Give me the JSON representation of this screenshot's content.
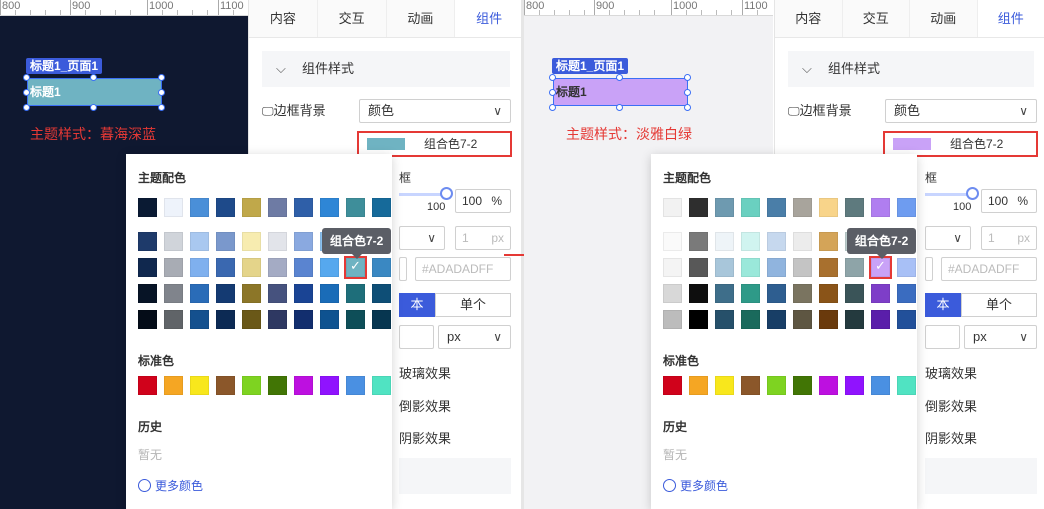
{
  "ruler": {
    "ticks": [
      "800",
      "900",
      "1000",
      "1100"
    ]
  },
  "panel": {
    "tabs": [
      "内容",
      "交互",
      "动画",
      "组件"
    ],
    "active_tab": "组件",
    "section_title": "组件样式",
    "border_bg_label": "边框背景",
    "border_bg_value": "颜色",
    "color_value_label": "组合色7-2",
    "percent_value": "100",
    "percent_unit": "%",
    "slider_max_label": "100",
    "px_value": "1",
    "px_unit_ghost": "px",
    "hex_placeholder": "#ADADADFF",
    "seg_left": "本",
    "seg_right": "单个",
    "unit_select": "px",
    "glass_label": "玻璃效果",
    "reflection_label": "倒影效果",
    "shadow_label": "阴影效果",
    "partial_label": "框"
  },
  "popup": {
    "theme_title": "主题配色",
    "standard_title": "标准色",
    "history_title": "历史",
    "history_empty": "暂无",
    "more_colors": "更多颜色",
    "tooltip": "组合色7-2",
    "standard_colors": [
      "#d0021b",
      "#f5a623",
      "#f8e71c",
      "#8b572a",
      "#7ed321",
      "#417505",
      "#bd10e0",
      "#9013fe",
      "#4a90e2",
      "#50e3c2"
    ]
  },
  "left": {
    "tag": "标题1_页面1",
    "widget_text": "标题1",
    "caption": "主题样式：暮海深蓝",
    "widget_color": "#6fb3c2",
    "swatch_color": "#6fb3c2",
    "theme_row": [
      "#0a1a33",
      "#eef3fb",
      "#4a8fd8",
      "#1e4a8a",
      "#c0a84a",
      "#6e7ba4",
      "#2f5fa8",
      "#2e86d6",
      "#3e8e9a",
      "#166a9a"
    ],
    "grid_rows": [
      [
        "#1e3a6a",
        "#d0d4da",
        "#a9c8f0",
        "#7a98cc",
        "#f7ecb0",
        "#e2e4ea",
        "#8aa9e0",
        "#8ac0ee",
        "#9ed0d8",
        "#8ab8d8"
      ],
      [
        "#10284e",
        "#a8acb4",
        "#7fb0ee",
        "#3a68b0",
        "#e4d48a",
        "#a4abc4",
        "#5a84d0",
        "#56a8ee",
        "#6fb3c2",
        "#3a88c2"
      ],
      [
        "#071426",
        "#80848c",
        "#2a6cb8",
        "#143a72",
        "#8c7628",
        "#46527e",
        "#1a4494",
        "#1a6cb8",
        "#1e6e7a",
        "#0e4e76"
      ],
      [
        "#040c18",
        "#606468",
        "#14508e",
        "#0c2a54",
        "#6a5818",
        "#2e3862",
        "#122e6e",
        "#0e5290",
        "#0e4e58",
        "#073650"
      ]
    ]
  },
  "right": {
    "tag": "标题1_页面1",
    "widget_text": "标题1",
    "caption": "主题样式：淡雅白绿",
    "widget_color": "#c9a2f7",
    "swatch_color": "#c9a2f7",
    "theme_row": [
      "#f2f2f2",
      "#2e2e2e",
      "#6e9ab0",
      "#6ad0c0",
      "#4a7ea8",
      "#a8a49c",
      "#f8d48a",
      "#5e7a7e",
      "#b07ef0",
      "#6e9cf0"
    ],
    "grid_rows": [
      [
        "#fafafa",
        "#7a7a7a",
        "#eef4f8",
        "#d0f4f0",
        "#c6d8ee",
        "#ececec",
        "#d4a458",
        "#bccccc",
        "#e2d0fa",
        "#cedcfa"
      ],
      [
        "#f4f4f4",
        "#585858",
        "#a8c6da",
        "#9ae8da",
        "#90b4de",
        "#c4c4c4",
        "#a8702e",
        "#8ea4a8",
        "#c9a2f7",
        "#a8c0f6"
      ],
      [
        "#d8d8d8",
        "#0e0e0e",
        "#3e6e8a",
        "#2e9a88",
        "#2e5e90",
        "#7a7460",
        "#8a5418",
        "#3a5458",
        "#7e3ec8",
        "#3a6cc0"
      ],
      [
        "#bcbcbc",
        "#000000",
        "#26506a",
        "#1a6a5c",
        "#183e66",
        "#5e5642",
        "#6a3a0c",
        "#243a3e",
        "#5a1eaa",
        "#22509a"
      ]
    ]
  }
}
